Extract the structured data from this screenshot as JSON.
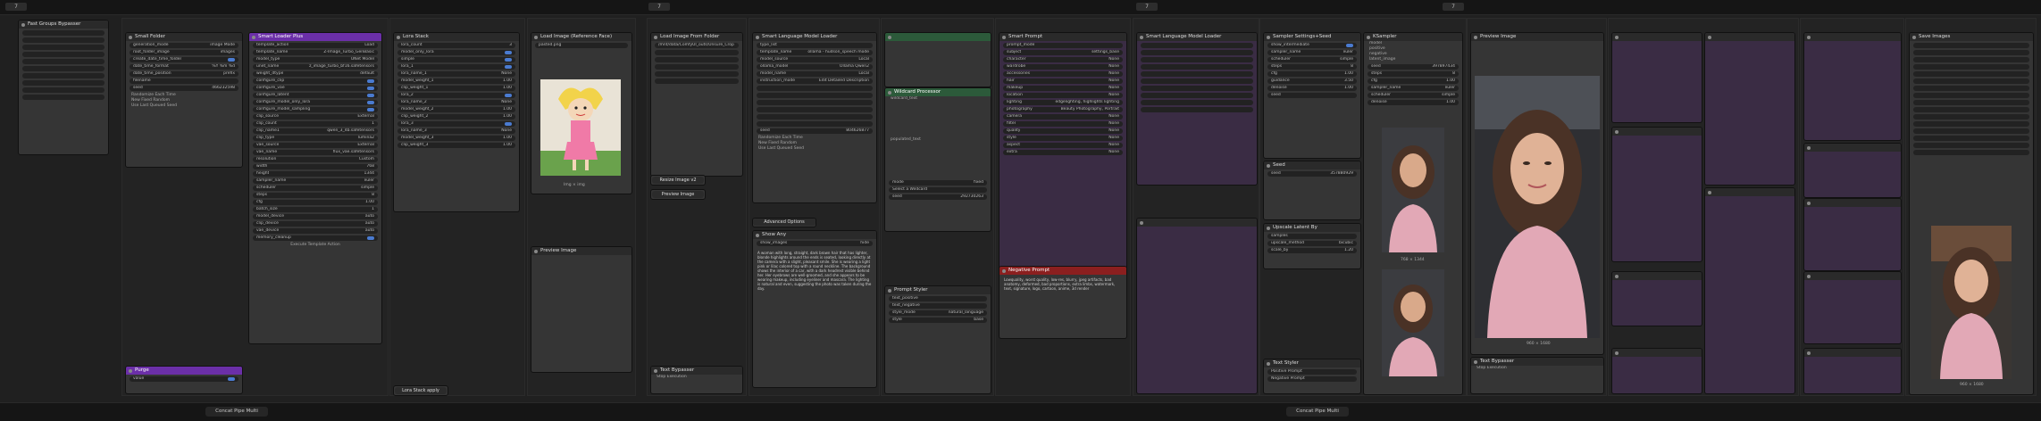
{
  "topbar": {
    "tags": [
      "7",
      "7",
      "7",
      "7"
    ]
  },
  "bottombar": {
    "items": [
      "Concat Pipe Multi",
      "Concat Pipe Multi",
      "Lora Stack apply"
    ]
  },
  "fast_groups": {
    "title": "Fast Groups Bypasser"
  },
  "small_folder": {
    "title": "Small Folder",
    "rows": [
      [
        "generation_mode",
        "image Mode"
      ],
      [
        "root_folder_image",
        "images"
      ],
      [
        "create_date_time_folder",
        ""
      ],
      [
        "date_time_format",
        "%Y %m %d"
      ],
      [
        "date_time_position",
        "prefix"
      ],
      [
        "filename",
        ""
      ],
      [
        "seed",
        "466232598"
      ]
    ],
    "buttons": [
      "Randomize Each Time",
      "New Fixed Random",
      "Use Last Queued Seed"
    ]
  },
  "smart_loader": {
    "title": "Smart Loader Plus",
    "rows": [
      [
        "template_action",
        "Load"
      ],
      [
        "template_name",
        "Z-Image_Turbo_GenBasic"
      ],
      [
        "model_type",
        "UNet Model"
      ],
      [
        "unet_name",
        "z_image_turbo_bf16.safetensors"
      ],
      [
        "weight_dtype",
        "default"
      ],
      [
        "configure_clip",
        ""
      ],
      [
        "configure_vae",
        ""
      ],
      [
        "configure_latent",
        ""
      ],
      [
        "configure_model_only_lora",
        ""
      ],
      [
        "configure_model_sampling",
        ""
      ],
      [
        "clip_source",
        "External"
      ],
      [
        "clip_count",
        "1"
      ],
      [
        "clip_name1",
        "qwen_3_4b.safetensors"
      ],
      [
        "clip_type",
        "lumina2"
      ],
      [
        "vae_source",
        "External"
      ],
      [
        "vae_name",
        "flux_vae.safetensors"
      ],
      [
        "resolution",
        "Custom"
      ],
      [
        "width",
        "768"
      ],
      [
        "height",
        "1344"
      ],
      [
        "sampler_name",
        "euler"
      ],
      [
        "scheduler",
        "simple"
      ],
      [
        "steps",
        "8"
      ],
      [
        "cfg",
        "1.00"
      ],
      [
        "batch_size",
        "1"
      ],
      [
        "model_device",
        "auto"
      ],
      [
        "clip_device",
        "auto"
      ],
      [
        "vae_device",
        "auto"
      ],
      [
        "memory_cleanup",
        ""
      ]
    ],
    "footer": "Execute Template Action"
  },
  "lora_stack": {
    "title": "Lora Stack",
    "rows": [
      [
        "lora_count",
        "3"
      ],
      [
        "model_only_lora",
        ""
      ],
      [
        "simple",
        ""
      ],
      [
        "lora_1",
        ""
      ],
      [
        "lora_name_1",
        "None"
      ],
      [
        "model_weight_1",
        "1.00"
      ],
      [
        "clip_weight_1",
        "1.00"
      ],
      [
        "lora_2",
        ""
      ],
      [
        "lora_name_2",
        "None"
      ],
      [
        "model_weight_2",
        "1.00"
      ],
      [
        "clip_weight_2",
        "1.00"
      ],
      [
        "lora_3",
        ""
      ],
      [
        "lora_name_3",
        "None"
      ],
      [
        "model_weight_3",
        "1.00"
      ],
      [
        "clip_weight_3",
        "1.00"
      ]
    ],
    "apply": "Lora Stack apply"
  },
  "purge": {
    "title": "Purge",
    "value": "value"
  },
  "reference_face": {
    "title": "Load Image (Reference Face)",
    "filename": "pasted.png",
    "caption": "Img × img",
    "preview": "Preview Image"
  },
  "load_folder": {
    "title": "Load Image From Folder",
    "path": "/mnt/data/ComfyUI_outs/Unsure_Crop",
    "buttons": [
      "Resize Image v2",
      "Preview Image"
    ],
    "bypasser": "Text Bypasser",
    "stop": "Stop Execution"
  },
  "smart_llm": {
    "title": "Smart Language Model Loader",
    "rows": [
      [
        "type_list",
        ""
      ],
      [
        "template_name",
        "ollama - hudson_speech mode"
      ],
      [
        "model_source",
        "Local"
      ],
      [
        "ollama_model",
        "Ollama Qwen2"
      ],
      [
        "model_name",
        "Local"
      ],
      [
        "instruction_mode",
        "Edit Detailed Description"
      ],
      [
        "seed",
        "804626877"
      ]
    ],
    "buttons": [
      "Randomize Each Time",
      "New Fixed Random",
      "Use Last Queued Seed"
    ],
    "advanced": "Advanced Options",
    "show_any": "Show Any",
    "show_images": "hide"
  },
  "description": {
    "text": "A woman with long, straight, dark brown hair that has lighter, blonde highlights around the ends is seated, looking directly at the camera with a slight, pleasant smile. She is wearing a light pink or lilac colored top with a round neckline. The background shows the interior of a car, with a dark headrest visible behind her. Her eyebrows are well-groomed, and she appears to be wearing makeup, including eyeliner and mascara. The lighting is natural and even, suggesting the photo was taken during the day."
  },
  "wildcard": {
    "title": "Wildcard Processor",
    "wildcard_text": "wildcard_text",
    "populated_text": "populated_text",
    "mode": "fixed",
    "select": "Select a Wildcard",
    "seed": "292730263"
  },
  "prompt_styler": {
    "title": "Prompt Styler",
    "rows": [
      [
        "text_positive",
        ""
      ],
      [
        "text_negative",
        ""
      ],
      [
        "style_mode",
        "natural_language"
      ],
      [
        "style",
        "base"
      ]
    ]
  },
  "strong_prompt": {
    "title": "Smart Prompt",
    "rows": [
      [
        "prompt_mode",
        ""
      ],
      [
        "subject",
        "settings_base"
      ],
      [
        "character",
        "None"
      ],
      [
        "wardrobe",
        "None"
      ],
      [
        "accessories",
        "None"
      ],
      [
        "hair",
        "None"
      ],
      [
        "makeup",
        "None"
      ],
      [
        "location",
        "None"
      ],
      [
        "lighting",
        "edgelighting, highlights lighting"
      ],
      [
        "photography",
        "Beauty Photography, Portrait"
      ],
      [
        "camera",
        "None"
      ],
      [
        "filter",
        "None"
      ],
      [
        "quality",
        "None"
      ],
      [
        "style",
        "None"
      ],
      [
        "aspect",
        "None"
      ],
      [
        "extra",
        "None"
      ]
    ]
  },
  "negative": {
    "title": "Negative Prompt",
    "text": "Lowquality, worst quality, low-res, blurry, jpeg artifacts, bad anatomy, deformed, bad proportions, extra limbs, watermark, text, signature, logo, cartoon, anime, 3d render"
  },
  "sampler_settings": {
    "title": "Sampler Settings+Seed",
    "rows": [
      [
        "show_intermediate",
        ""
      ],
      [
        "sampler_name",
        "euler"
      ],
      [
        "scheduler",
        "simple"
      ],
      [
        "steps",
        "8"
      ],
      [
        "cfg",
        "1.00"
      ],
      [
        "guidance",
        "3.50"
      ],
      [
        "denoise",
        "1.00"
      ],
      [
        "seed",
        ""
      ]
    ]
  },
  "ksampler": {
    "title": "KSampler",
    "rows": [
      [
        "model",
        ""
      ],
      [
        "positive",
        ""
      ],
      [
        "negative",
        ""
      ],
      [
        "latent_image",
        ""
      ],
      [
        "seed",
        "397897434"
      ],
      [
        "steps",
        "8"
      ],
      [
        "cfg",
        "1.00"
      ],
      [
        "sampler_name",
        "euler"
      ],
      [
        "scheduler",
        "simple"
      ],
      [
        "denoise",
        "1.00"
      ]
    ],
    "caption": "768 × 1344"
  },
  "seed_node": {
    "title": "Seed",
    "seed": "357880929"
  },
  "upscale": {
    "title": "Upscale Latent By",
    "rows": [
      [
        "samples",
        ""
      ],
      [
        "upscale_method",
        "bicubic"
      ],
      [
        "scale_by",
        "1.20"
      ]
    ]
  },
  "text_styler": {
    "title": "Text Styler",
    "rows": [
      [
        "Positive Prompt",
        ""
      ],
      [
        "Negative Prompt",
        ""
      ]
    ]
  },
  "preview": {
    "title": "Preview Image",
    "caption": "960 × 1680"
  },
  "save": {
    "title": "Save Images",
    "caption": "960 × 1680"
  }
}
